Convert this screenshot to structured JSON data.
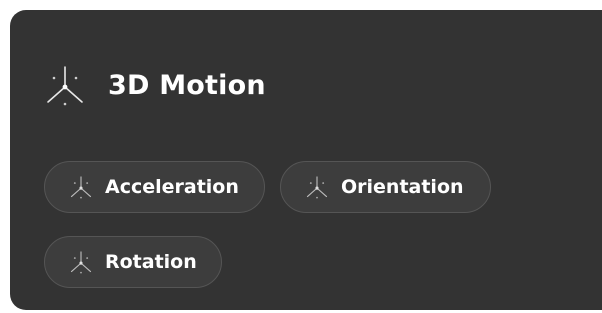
{
  "card": {
    "title": "3D Motion",
    "title_icon": "axes-3d-icon"
  },
  "chips": [
    {
      "label": "Acceleration",
      "icon": "axes-3d-icon"
    },
    {
      "label": "Orientation",
      "icon": "axes-3d-icon"
    },
    {
      "label": "Rotation",
      "icon": "axes-3d-icon"
    }
  ],
  "colors": {
    "card_background": "#333333",
    "chip_background": "#3d3d3d",
    "chip_border": "#555555",
    "text": "#ffffff"
  }
}
